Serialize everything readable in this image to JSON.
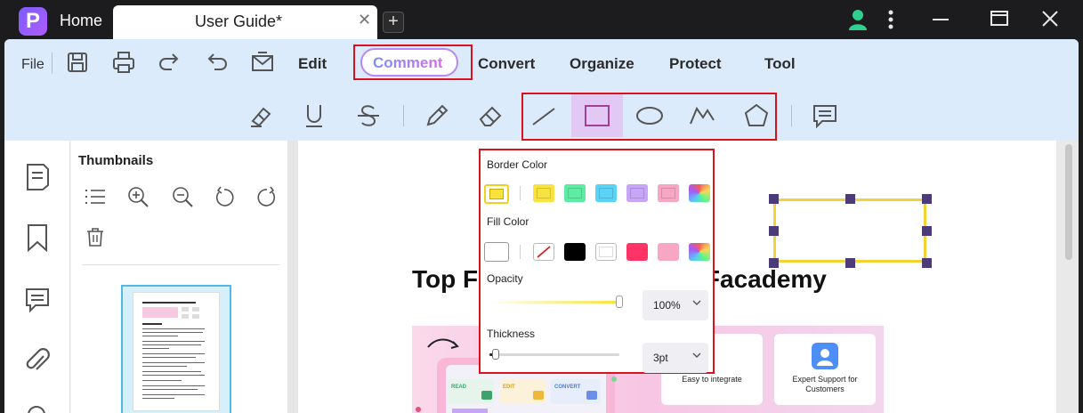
{
  "titlebar": {
    "app_logo": "P",
    "home_tab": "Home",
    "doc_tab": "User Guide*",
    "new_tab": "+"
  },
  "menu": {
    "file": "File",
    "edit": "Edit",
    "comment": "Comment",
    "convert": "Convert",
    "organize": "Organize",
    "protect": "Protect",
    "tool": "Tool"
  },
  "comment_tools": [
    "highlight",
    "underline",
    "strikethrough",
    "pencil",
    "eraser",
    "line",
    "rectangle",
    "ellipse",
    "polyline",
    "polygon",
    "note"
  ],
  "active_tool": "rectangle",
  "sidebar": {
    "thumbnails_title": "Thumbnails"
  },
  "document": {
    "heading_left": "Top Fe",
    "heading_right": "DFacademy",
    "cards": [
      {
        "label": "Easy to integrate"
      },
      {
        "label": "Expert Support for Customers"
      }
    ]
  },
  "shape_popup": {
    "border_color_label": "Border Color",
    "border_selected": "#f7e33b",
    "border_colors": [
      "#f7e33b",
      "#5eeba3",
      "#5bd3f6",
      "#c8a6f7",
      "#f7a6c4",
      "multicolor"
    ],
    "fill_color_label": "Fill Color",
    "fill_selected": "#ffffff",
    "fill_colors": [
      "none",
      "#000000",
      "#ffffff",
      "#ff3366",
      "#f7a6c4",
      "multicolor"
    ],
    "opacity_label": "Opacity",
    "opacity_value": "100%",
    "opacity_level": 1.0,
    "thickness_label": "Thickness",
    "thickness_value": "3pt",
    "thickness_level": 0.05
  },
  "colors": {
    "accent_red": "#d9121b",
    "shape_border": "#f3d334",
    "handle": "#4b3b78",
    "menubar_bg": "#dcebfb"
  }
}
